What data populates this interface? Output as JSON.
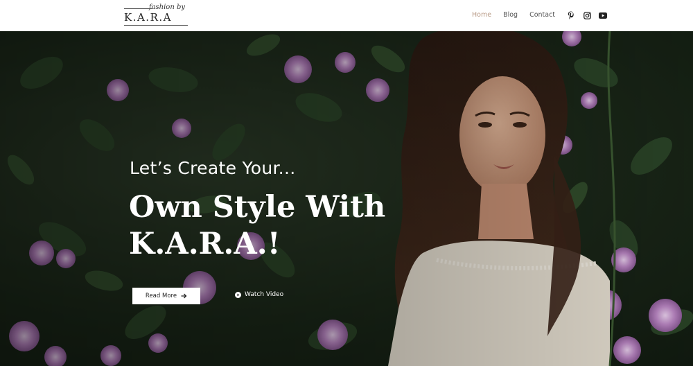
{
  "logo": {
    "tagline": "fashion by",
    "name": "K.A.R.A"
  },
  "nav": {
    "home": "Home",
    "blog": "Blog",
    "contact": "Contact"
  },
  "social": [
    "pinterest-icon",
    "instagram-icon",
    "youtube-icon"
  ],
  "hero": {
    "eyebrow": "Let’s Create Your...",
    "headline_line1": "Own Style With",
    "headline_line2": "K.A.R.A.!",
    "read_more": "Read More",
    "watch_video": "Watch Video"
  },
  "colors": {
    "nav_active": "#b89a86",
    "nav_text": "#555555",
    "hero_text": "#ffffff",
    "button_bg": "#ffffff"
  }
}
